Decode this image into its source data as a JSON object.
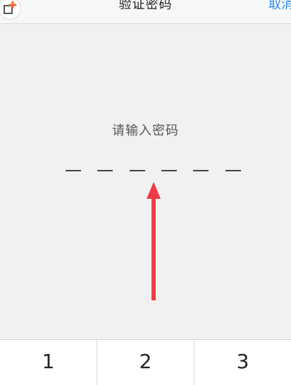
{
  "header": {
    "title": "验证密码",
    "cancel_label": "取消",
    "app_icon": "app-add-icon"
  },
  "main": {
    "prompt": "请输入密码",
    "pin_length": 6
  },
  "keypad": {
    "keys": [
      "1",
      "2",
      "3"
    ]
  },
  "colors": {
    "accent": "#2a8ee8",
    "arrow": "#ef3b45",
    "background": "#f1f1f1"
  }
}
